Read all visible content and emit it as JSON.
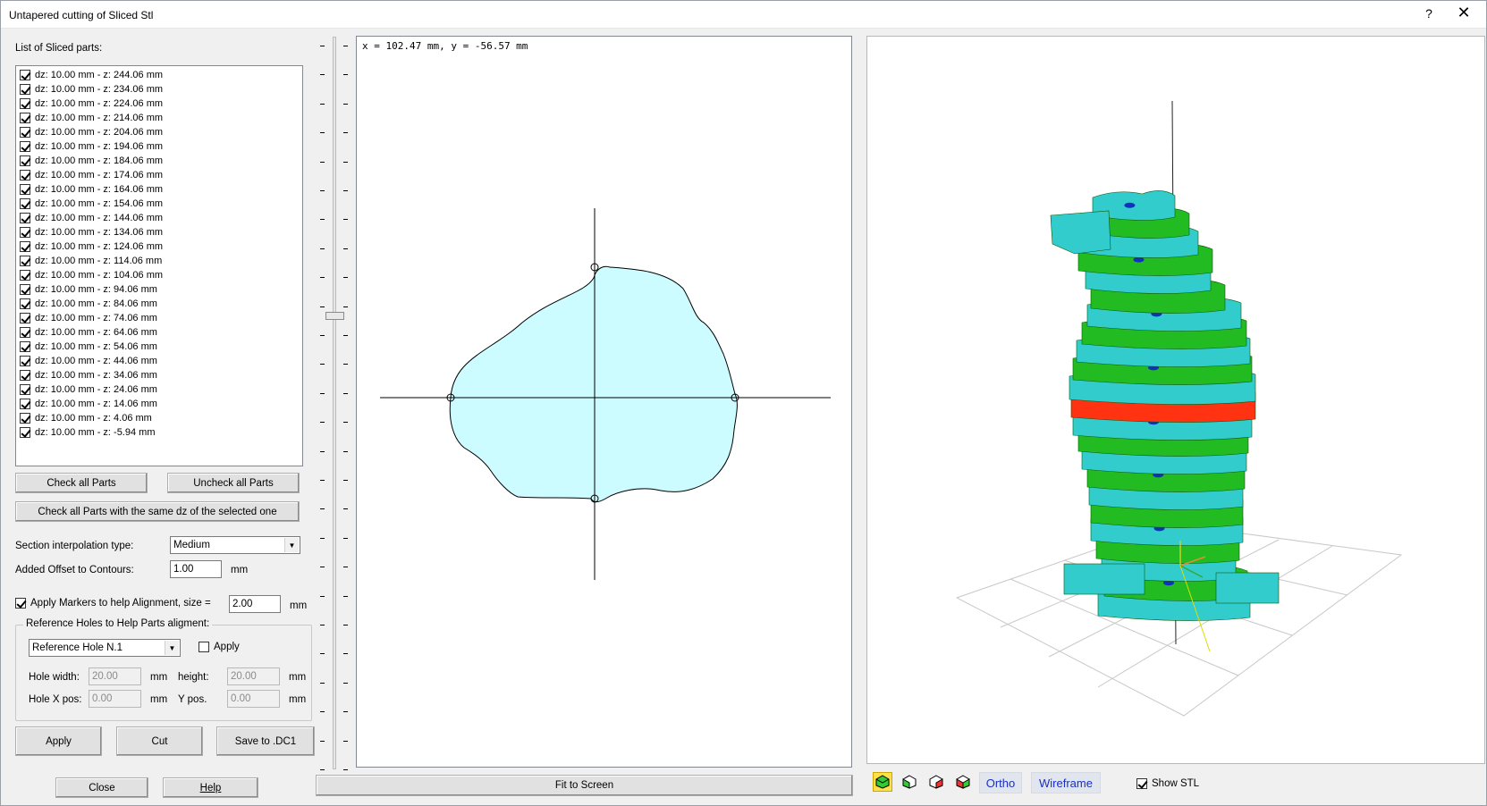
{
  "window": {
    "title": "Untapered cutting of Sliced Stl",
    "help_glyph": "?",
    "close_glyph": "✕"
  },
  "left": {
    "list_label": "List of Sliced parts:",
    "parts": [
      "dz: 10.00 mm - z: 244.06 mm",
      "dz: 10.00 mm - z: 234.06 mm",
      "dz: 10.00 mm - z: 224.06 mm",
      "dz: 10.00 mm - z: 214.06 mm",
      "dz: 10.00 mm - z: 204.06 mm",
      "dz: 10.00 mm - z: 194.06 mm",
      "dz: 10.00 mm - z: 184.06 mm",
      "dz: 10.00 mm - z: 174.06 mm",
      "dz: 10.00 mm - z: 164.06 mm",
      "dz: 10.00 mm - z: 154.06 mm",
      "dz: 10.00 mm - z: 144.06 mm",
      "dz: 10.00 mm - z: 134.06 mm",
      "dz: 10.00 mm - z: 124.06 mm",
      "dz: 10.00 mm - z: 114.06 mm",
      "dz: 10.00 mm - z: 104.06 mm",
      "dz: 10.00 mm - z: 94.06 mm",
      "dz: 10.00 mm - z: 84.06 mm",
      "dz: 10.00 mm - z: 74.06 mm",
      "dz: 10.00 mm - z: 64.06 mm",
      "dz: 10.00 mm - z: 54.06 mm",
      "dz: 10.00 mm - z: 44.06 mm",
      "dz: 10.00 mm - z: 34.06 mm",
      "dz: 10.00 mm - z: 24.06 mm",
      "dz: 10.00 mm - z: 14.06 mm",
      "dz: 10.00 mm - z: 4.06 mm",
      "dz: 10.00 mm - z: -5.94 mm"
    ],
    "check_all": "Check all Parts",
    "uncheck_all": "Uncheck all Parts",
    "check_same_dz": "Check all Parts with the same dz of the selected one",
    "interp_label": "Section interpolation type:",
    "interp_value": "Medium",
    "offset_label": "Added Offset to Contours:",
    "offset_value": "1.00",
    "offset_unit": "mm",
    "markers_label": "Apply Markers to help Alignment, size =",
    "markers_value": "2.00",
    "markers_unit": "mm",
    "holes_group": "Reference Holes to Help Parts aligment:",
    "hole_select": "Reference Hole N.1",
    "hole_apply": "Apply",
    "hole_width_label": "Hole width:",
    "hole_width": "20.00",
    "height_label": "height:",
    "height": "20.00",
    "hole_x_label": "Hole X pos:",
    "hole_x": "0.00",
    "y_pos_label": "Y pos.",
    "y_pos": "0.00",
    "mm": "mm",
    "apply_btn": "Apply",
    "cut_btn": "Cut",
    "save_btn": "Save to .DC1",
    "close_btn": "Close",
    "help_btn": "Help"
  },
  "view2d": {
    "coords": "x = 102.47 mm, y = -56.57 mm",
    "fit_btn": "Fit to Screen"
  },
  "view3d": {
    "ortho": "Ortho",
    "wireframe": "Wireframe",
    "show_stl": "Show STL"
  },
  "colors": {
    "slice_cyan": "#33cccc",
    "slice_green": "#22bb22",
    "slice_selected": "#ff3311",
    "contour_fill": "#ccfcff",
    "toolbar_active": "#ffdf4a"
  },
  "slider": {
    "position_fraction": 0.38
  }
}
